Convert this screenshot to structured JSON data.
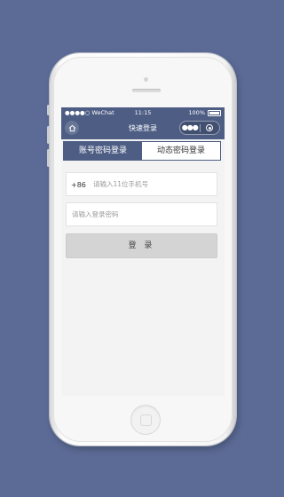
{
  "status_bar": {
    "carrier": "●●●●○ WeChat",
    "time": "11:15",
    "battery": "100%"
  },
  "nav": {
    "title": "快速登录",
    "more_icon": "more-dots-icon",
    "close_icon": "target-circle-icon",
    "home_icon": "home-icon"
  },
  "tabs": [
    {
      "label": "账号密码登录",
      "active": true
    },
    {
      "label": "动态密码登录",
      "active": false
    }
  ],
  "form": {
    "country_code": "+86",
    "phone_placeholder": "请输入11位手机号",
    "phone_value": "",
    "password_placeholder": "请输入登录密码",
    "password_value": "",
    "login_label": "登 录"
  },
  "colors": {
    "accent": "#4d5d84",
    "background": "#5b6b96",
    "button": "#d4d4d4"
  }
}
